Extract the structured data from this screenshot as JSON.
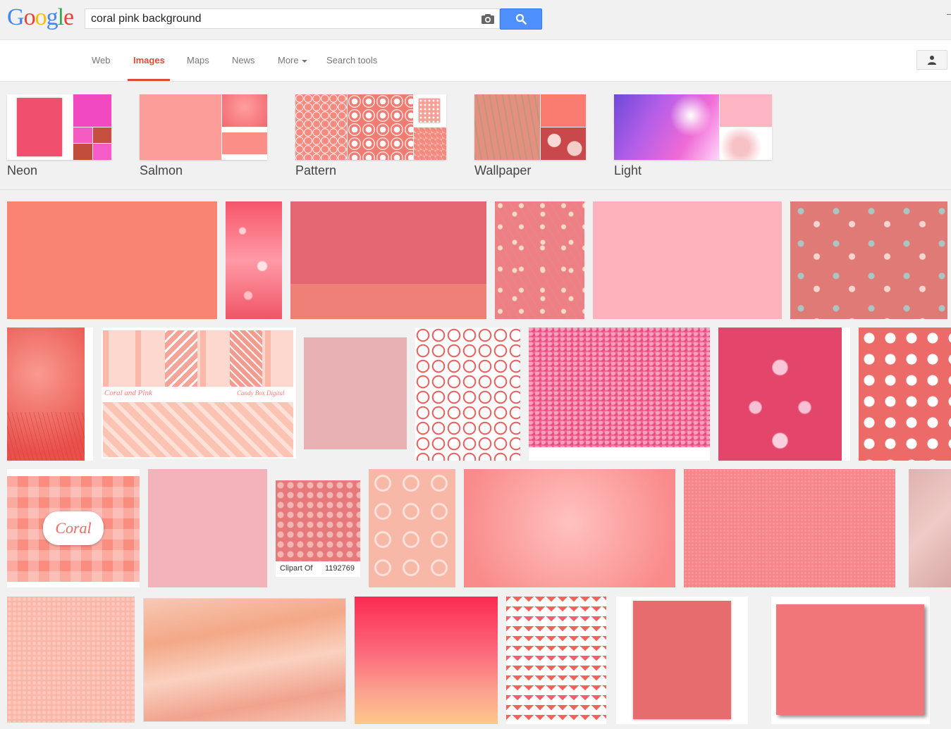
{
  "logo": {
    "letters": [
      "G",
      "o",
      "o",
      "g",
      "l",
      "e"
    ],
    "colors": [
      "#4285f4",
      "#ea4335",
      "#fbbc05",
      "#4285f4",
      "#34a853",
      "#ea4335"
    ]
  },
  "search": {
    "query": "coral pink background"
  },
  "nav": {
    "tabs": [
      {
        "label": "Web"
      },
      {
        "label": "Images"
      },
      {
        "label": "Maps"
      },
      {
        "label": "News"
      },
      {
        "label": "More"
      },
      {
        "label": "Search tools"
      }
    ],
    "active_tab": "Images",
    "accent": "#dd4b39"
  },
  "related": [
    {
      "label": "Neon"
    },
    {
      "label": "Salmon"
    },
    {
      "label": "Pattern"
    },
    {
      "label": "Wallpaper"
    },
    {
      "label": "Light"
    }
  ],
  "results": {
    "clipart_caption_left": "Clipart Of",
    "clipart_caption_right": "1192769",
    "coral_pack_label": "Coral",
    "candy_box_line1": "Coral and Pink",
    "candy_box_line2": "Candy Box Digital"
  }
}
